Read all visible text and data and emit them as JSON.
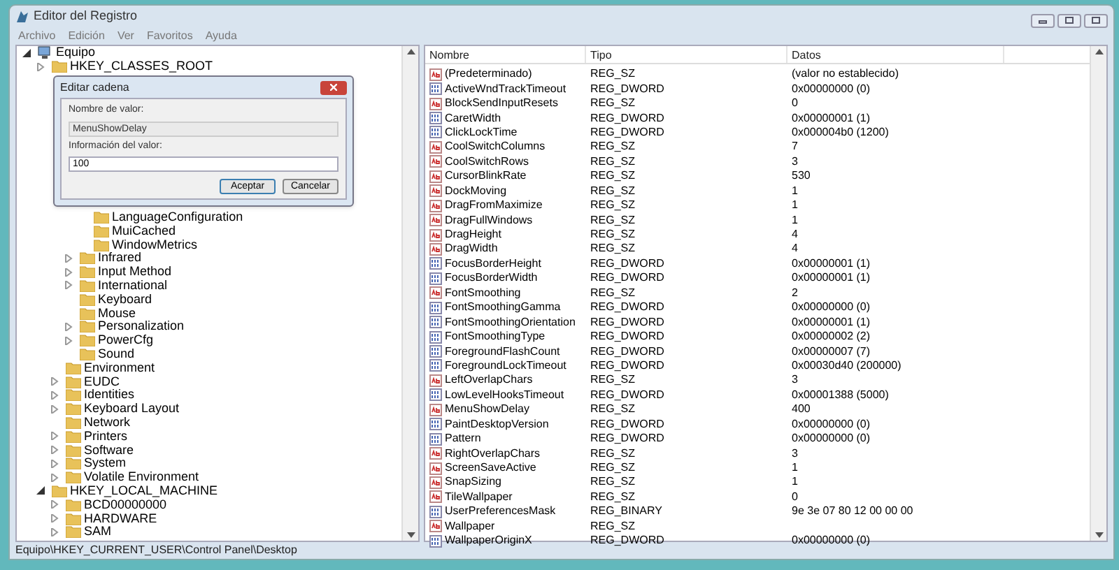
{
  "window": {
    "title": "Editor del Registro"
  },
  "menu": [
    "Archivo",
    "Edición",
    "Ver",
    "Favoritos",
    "Ayuda"
  ],
  "tree": [
    {
      "label": "Equipo",
      "expanded": true,
      "children": [
        {
          "label": "HKEY_CLASSES_ROOT",
          "expanded": false
        },
        {
          "children": [
            {
              "children": [
                {
                  "children": [
                    {
                      "label": "LanguageConfiguration"
                    },
                    {
                      "label": "MuiCached"
                    },
                    {
                      "label": "WindowMetrics"
                    }
                  ]
                },
                {
                  "label": "Infrared",
                  "expanded": false
                },
                {
                  "label": "Input Method",
                  "expanded": false
                },
                {
                  "label": "International",
                  "expanded": false
                },
                {
                  "label": "Keyboard"
                },
                {
                  "label": "Mouse"
                },
                {
                  "label": "Personalization",
                  "expanded": false
                },
                {
                  "label": "PowerCfg",
                  "expanded": false
                },
                {
                  "label": "Sound"
                }
              ]
            },
            {
              "label": "Environment"
            },
            {
              "label": "EUDC",
              "expanded": false
            },
            {
              "label": "Identities",
              "expanded": false
            },
            {
              "label": "Keyboard Layout",
              "expanded": false
            },
            {
              "label": "Network"
            },
            {
              "label": "Printers",
              "expanded": false
            },
            {
              "label": "Software",
              "expanded": false
            },
            {
              "label": "System",
              "expanded": false
            },
            {
              "label": "Volatile Environment",
              "expanded": false
            }
          ]
        },
        {
          "label": "HKEY_LOCAL_MACHINE",
          "expanded": true,
          "children": [
            {
              "label": "BCD00000000",
              "expanded": false
            },
            {
              "label": "HARDWARE",
              "expanded": false
            },
            {
              "label": "SAM",
              "expanded": false
            }
          ]
        }
      ]
    }
  ],
  "table": {
    "columns": [
      "Nombre",
      "Tipo",
      "Datos"
    ],
    "rows": [
      {
        "kind": "sz",
        "name": "(Predeterminado)",
        "type": "REG_SZ",
        "data": "(valor no establecido)"
      },
      {
        "kind": "bin",
        "name": "ActiveWndTrackTimeout",
        "type": "REG_DWORD",
        "data": "0x00000000 (0)"
      },
      {
        "kind": "sz",
        "name": "BlockSendInputResets",
        "type": "REG_SZ",
        "data": "0"
      },
      {
        "kind": "bin",
        "name": "CaretWidth",
        "type": "REG_DWORD",
        "data": "0x00000001 (1)"
      },
      {
        "kind": "bin",
        "name": "ClickLockTime",
        "type": "REG_DWORD",
        "data": "0x000004b0 (1200)"
      },
      {
        "kind": "sz",
        "name": "CoolSwitchColumns",
        "type": "REG_SZ",
        "data": "7"
      },
      {
        "kind": "sz",
        "name": "CoolSwitchRows",
        "type": "REG_SZ",
        "data": "3"
      },
      {
        "kind": "sz",
        "name": "CursorBlinkRate",
        "type": "REG_SZ",
        "data": "530"
      },
      {
        "kind": "sz",
        "name": "DockMoving",
        "type": "REG_SZ",
        "data": "1"
      },
      {
        "kind": "sz",
        "name": "DragFromMaximize",
        "type": "REG_SZ",
        "data": "1"
      },
      {
        "kind": "sz",
        "name": "DragFullWindows",
        "type": "REG_SZ",
        "data": "1"
      },
      {
        "kind": "sz",
        "name": "DragHeight",
        "type": "REG_SZ",
        "data": "4"
      },
      {
        "kind": "sz",
        "name": "DragWidth",
        "type": "REG_SZ",
        "data": "4"
      },
      {
        "kind": "bin",
        "name": "FocusBorderHeight",
        "type": "REG_DWORD",
        "data": "0x00000001 (1)"
      },
      {
        "kind": "bin",
        "name": "FocusBorderWidth",
        "type": "REG_DWORD",
        "data": "0x00000001 (1)"
      },
      {
        "kind": "sz",
        "name": "FontSmoothing",
        "type": "REG_SZ",
        "data": "2"
      },
      {
        "kind": "bin",
        "name": "FontSmoothingGamma",
        "type": "REG_DWORD",
        "data": "0x00000000 (0)"
      },
      {
        "kind": "bin",
        "name": "FontSmoothingOrientation",
        "type": "REG_DWORD",
        "data": "0x00000001 (1)"
      },
      {
        "kind": "bin",
        "name": "FontSmoothingType",
        "type": "REG_DWORD",
        "data": "0x00000002 (2)"
      },
      {
        "kind": "bin",
        "name": "ForegroundFlashCount",
        "type": "REG_DWORD",
        "data": "0x00000007 (7)"
      },
      {
        "kind": "bin",
        "name": "ForegroundLockTimeout",
        "type": "REG_DWORD",
        "data": "0x00030d40 (200000)"
      },
      {
        "kind": "sz",
        "name": "LeftOverlapChars",
        "type": "REG_SZ",
        "data": "3"
      },
      {
        "kind": "bin",
        "name": "LowLevelHooksTimeout",
        "type": "REG_DWORD",
        "data": "0x00001388 (5000)"
      },
      {
        "kind": "sz",
        "name": "MenuShowDelay",
        "type": "REG_SZ",
        "data": "400"
      },
      {
        "kind": "bin",
        "name": "PaintDesktopVersion",
        "type": "REG_DWORD",
        "data": "0x00000000 (0)"
      },
      {
        "kind": "bin",
        "name": "Pattern",
        "type": "REG_DWORD",
        "data": "0x00000000 (0)"
      },
      {
        "kind": "sz",
        "name": "RightOverlapChars",
        "type": "REG_SZ",
        "data": "3"
      },
      {
        "kind": "sz",
        "name": "ScreenSaveActive",
        "type": "REG_SZ",
        "data": "1"
      },
      {
        "kind": "sz",
        "name": "SnapSizing",
        "type": "REG_SZ",
        "data": "1"
      },
      {
        "kind": "sz",
        "name": "TileWallpaper",
        "type": "REG_SZ",
        "data": "0"
      },
      {
        "kind": "bin",
        "name": "UserPreferencesMask",
        "type": "REG_BINARY",
        "data": "9e 3e 07 80 12 00 00 00"
      },
      {
        "kind": "sz",
        "name": "Wallpaper",
        "type": "REG_SZ"
      },
      {
        "kind": "bin",
        "name": "WallpaperOriginX",
        "type": "REG_DWORD",
        "data": "0x00000000 (0)"
      }
    ]
  },
  "dialog": {
    "title": "Editar cadena",
    "name_label": "Nombre de valor:",
    "name_value": "MenuShowDelay",
    "data_label": "Información del valor:",
    "data_value": "100",
    "buttons": [
      {
        "label": "Aceptar",
        "default": true
      },
      {
        "label": "Cancelar",
        "default": false
      }
    ]
  },
  "status_bar": "Equipo\\HKEY_CURRENT_USER\\Control Panel\\Desktop"
}
